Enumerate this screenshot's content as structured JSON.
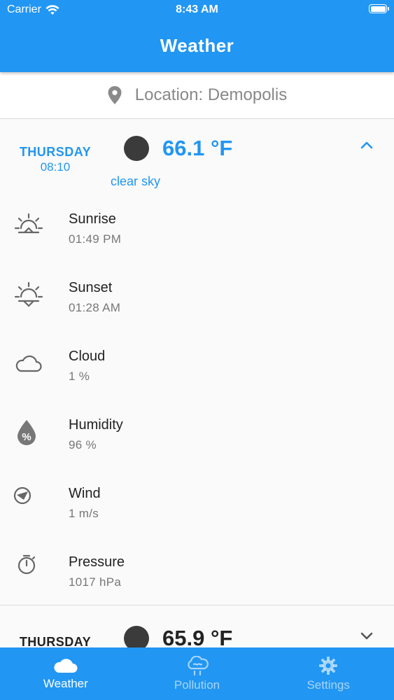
{
  "status_bar": {
    "carrier": "Carrier",
    "time": "8:43 AM",
    "battery_level": 1.0
  },
  "appbar": {
    "title": "Weather"
  },
  "location": {
    "label": "Location: Demopolis",
    "icon": "location-pin-icon"
  },
  "forecast": [
    {
      "day": "THURSDAY",
      "time": "08:10",
      "temperature": "66.1 °F",
      "description": "clear sky",
      "expanded": true,
      "details": [
        {
          "label": "Sunrise",
          "value": "01:49 PM",
          "icon": "sunrise-icon"
        },
        {
          "label": "Sunset",
          "value": "01:28 AM",
          "icon": "sunset-icon"
        },
        {
          "label": "Cloud",
          "value": "1 %",
          "icon": "cloud-icon"
        },
        {
          "label": "Humidity",
          "value": "96 %",
          "icon": "humidity-icon"
        },
        {
          "label": "Wind",
          "value": "1 m/s",
          "icon": "wind-icon"
        },
        {
          "label": "Pressure",
          "value": "1017 hPa",
          "icon": "pressure-icon"
        }
      ]
    },
    {
      "day": "THURSDAY",
      "temperature": "65.9 °F",
      "expanded": false
    }
  ],
  "bottom_nav": [
    {
      "label": "Weather",
      "icon": "cloud-icon",
      "active": true
    },
    {
      "label": "Pollution",
      "icon": "pollution-icon",
      "active": false
    },
    {
      "label": "Settings",
      "icon": "gear-icon",
      "active": false
    }
  ],
  "colors": {
    "primary": "#2196f3",
    "background": "#fafafa",
    "weather_dot": "#3b3b3b"
  }
}
